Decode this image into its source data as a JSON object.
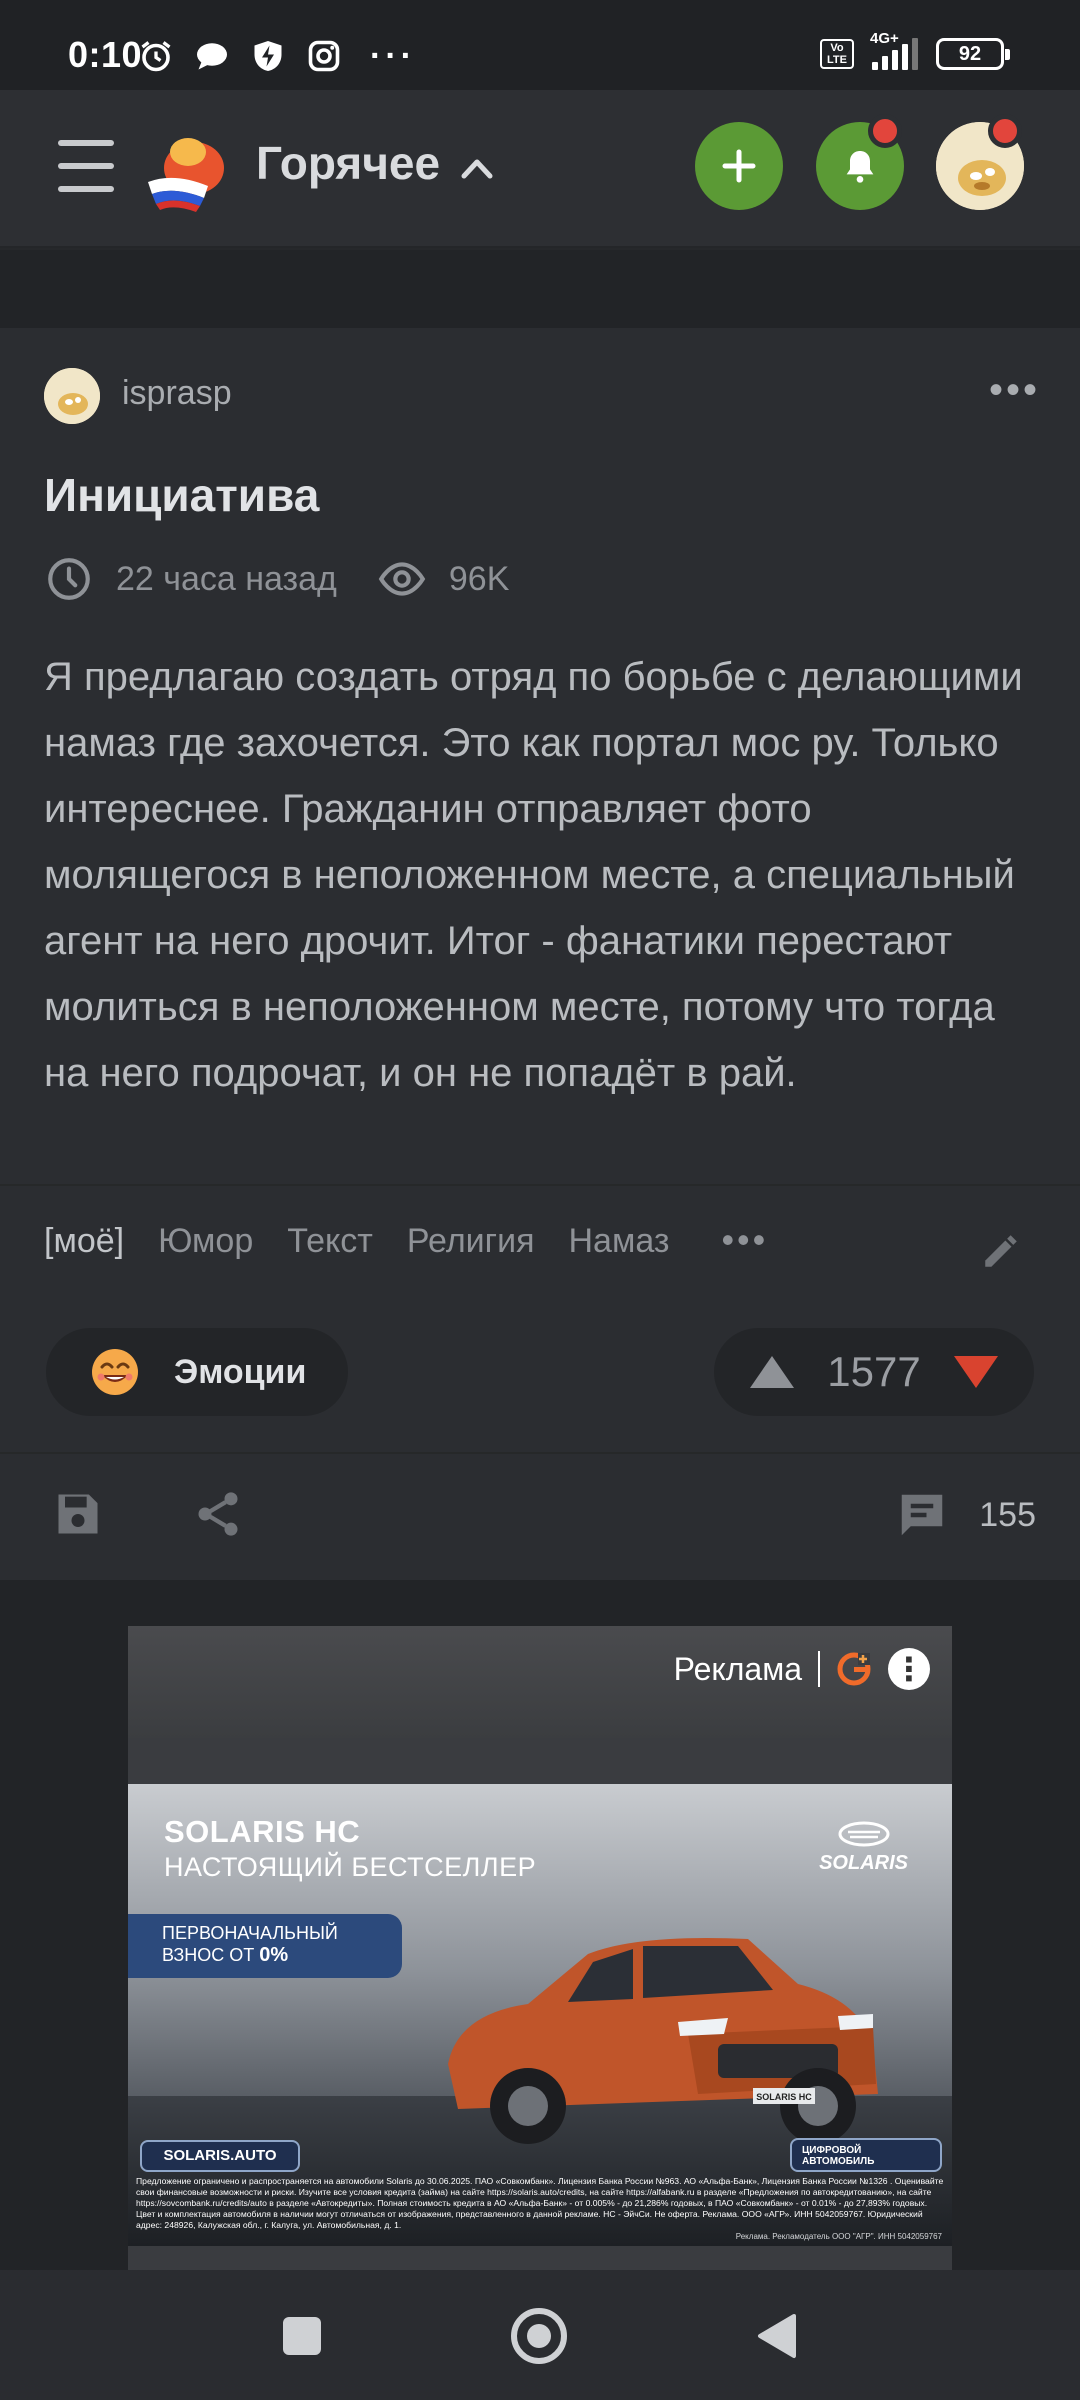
{
  "status_bar": {
    "time": "0:10",
    "network": "4G+",
    "volte": "Vo LTE",
    "battery": "92",
    "more": "···"
  },
  "header": {
    "title": "Горячее"
  },
  "post": {
    "author": "isprasp",
    "title": "Инициатива",
    "time_ago": "22 часа назад",
    "views": "96K",
    "body": "Я предлагаю создать отряд по борьбе с делающими намаз где захочется. Это как портал мос ру. Только интереснее. Гражданин отправляет фото молящегося в неположенном месте, а специальный агент на него дрочит. Итог - фанатики перестают молиться в неположенном месте, потому что тогда на него подрочат, и он не попадёт в рай.",
    "tags": [
      "[моё]",
      "Юмор",
      "Текст",
      "Религия",
      "Намаз"
    ],
    "tags_more": "•••",
    "emotions_label": "Эмоции",
    "rating": "1577",
    "comments": "155"
  },
  "ad": {
    "label": "Реклама",
    "headline": "SOLARIS HC",
    "subheadline": "НАСТОЯЩИЙ БЕСТСЕЛЛЕР",
    "offer_line1": "ПЕРВОНАЧАЛЬНЫЙ",
    "offer_line2": "ВЗНОС ОТ",
    "offer_value": "0%",
    "brand": "SOLARIS",
    "plate": "SOLARIS HC",
    "site": "SOLARIS.AUTO",
    "digital_line1": "ЦИФРОВОЙ",
    "digital_line2": "АВТОМОБИЛЬ",
    "disclaimer": "Предложение ограничено и распространяется на автомобили Solaris до 30.06.2025. ПАО «Совкомбанк». Лицензия Банка России №963. АО «Альфа-Банк», Лицензия Банка России №1326 . Оценивайте свои финансовые возможности и риски. Изучите все условия кредита (займа) на сайте https://solaris.auto/credits, на сайте https://alfabank.ru в разделе «Предложения по автокредитованию», на сайте https://sovcombank.ru/credits/auto в разделе «Автокредиты». Полная стоимость кредита в АО «Альфа-Банк» - от 0.005% - до 21,286% годовых, в ПАО «Совкомбанк» - от 0.01% - до 27,893% годовых. Цвет и комплектация автомобиля в наличии могут отличаться от изображения, представленного в данной рекламе. НС - ЭйчСи. Не оферта. Реклама. ООО «АГР». ИНН 5042059767. Юридический адрес: 248926, Калужская обл., г. Калуга, ул. Автомобильная, д. 1.",
    "advertiser": "Реклама. Рекламодатель ООО \"АГР\". ИНН 5042059767"
  },
  "colors": {
    "accent_green": "#5b9a35",
    "badge_red": "#e2453c",
    "downvote_red": "#d9432f",
    "background": "#26282b"
  }
}
